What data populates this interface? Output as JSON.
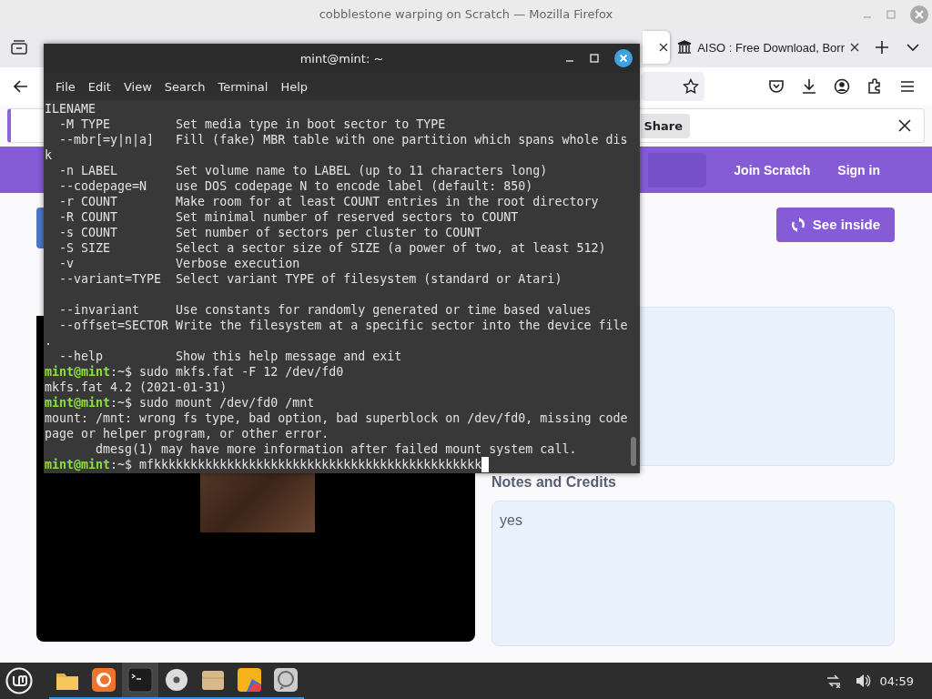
{
  "browser": {
    "title": "cobblestone warping on Scratch — Mozilla Firefox",
    "tabs": [
      {
        "selected": true
      },
      {
        "label": "AISO : Free Download, Borr",
        "selected": false
      }
    ],
    "notification": {
      "button": "Share"
    },
    "scratch": {
      "nav": [
        "Join Scratch",
        "Sign in"
      ],
      "see_inside": "See inside",
      "notes_heading": "Notes and Credits",
      "notes": "yes"
    }
  },
  "terminal": {
    "title": "mint@mint: ~",
    "menu": [
      "File",
      "Edit",
      "View",
      "Search",
      "Terminal",
      "Help"
    ],
    "lines": [
      {
        "kind": "text",
        "text": "ILENAME"
      },
      {
        "kind": "text",
        "text": "  -M TYPE         Set media type in boot sector to TYPE"
      },
      {
        "kind": "text",
        "text": "  --mbr[=y|n|a]   Fill (fake) MBR table with one partition which spans whole dis"
      },
      {
        "kind": "text",
        "text": "k"
      },
      {
        "kind": "text",
        "text": "  -n LABEL        Set volume name to LABEL (up to 11 characters long)"
      },
      {
        "kind": "text",
        "text": "  --codepage=N    use DOS codepage N to encode label (default: 850)"
      },
      {
        "kind": "text",
        "text": "  -r COUNT        Make room for at least COUNT entries in the root directory"
      },
      {
        "kind": "text",
        "text": "  -R COUNT        Set minimal number of reserved sectors to COUNT"
      },
      {
        "kind": "text",
        "text": "  -s COUNT        Set number of sectors per cluster to COUNT"
      },
      {
        "kind": "text",
        "text": "  -S SIZE         Select a sector size of SIZE (a power of two, at least 512)"
      },
      {
        "kind": "text",
        "text": "  -v              Verbose execution"
      },
      {
        "kind": "text",
        "text": "  --variant=TYPE  Select variant TYPE of filesystem (standard or Atari)"
      },
      {
        "kind": "blank"
      },
      {
        "kind": "text",
        "text": "  --invariant     Use constants for randomly generated or time based values"
      },
      {
        "kind": "text",
        "text": "  --offset=SECTOR Write the filesystem at a specific sector into the device file"
      },
      {
        "kind": "text",
        "text": "."
      },
      {
        "kind": "text",
        "text": "  --help          Show this help message and exit"
      },
      {
        "kind": "prompt",
        "user_host": "mint@mint",
        "path": ":~$",
        "command": "sudo mkfs.fat -F 12 /dev/fd0",
        "cursor": false
      },
      {
        "kind": "text",
        "text": "mkfs.fat 4.2 (2021-01-31)"
      },
      {
        "kind": "prompt",
        "user_host": "mint@mint",
        "path": ":~$",
        "command": "sudo mount /dev/fd0 /mnt",
        "cursor": false
      },
      {
        "kind": "text",
        "text": "mount: /mnt: wrong fs type, bad option, bad superblock on /dev/fd0, missing code"
      },
      {
        "kind": "text",
        "text": "page or helper program, or other error."
      },
      {
        "kind": "text",
        "text": "       dmesg(1) may have more information after failed mount system call."
      },
      {
        "kind": "prompt",
        "user_host": "mint@mint",
        "path": ":~$",
        "command": "mfkkkkkkkkkkkkkkkkkkkkkkkkkkkkkkkkkkkkkkkkkkkkk",
        "cursor": true
      }
    ]
  },
  "taskbar": {
    "launchers": [
      {
        "kind": "folder",
        "running": true,
        "selected": false
      },
      {
        "kind": "firefox",
        "running": true,
        "selected": false
      },
      {
        "kind": "terminal",
        "running": true,
        "selected": true
      },
      {
        "kind": "disc",
        "running": true,
        "selected": false
      },
      {
        "kind": "archive",
        "running": true,
        "selected": false
      },
      {
        "kind": "paint",
        "running": true,
        "selected": false
      },
      {
        "kind": "chat",
        "running": true,
        "selected": false
      }
    ],
    "clock": "04:59"
  }
}
